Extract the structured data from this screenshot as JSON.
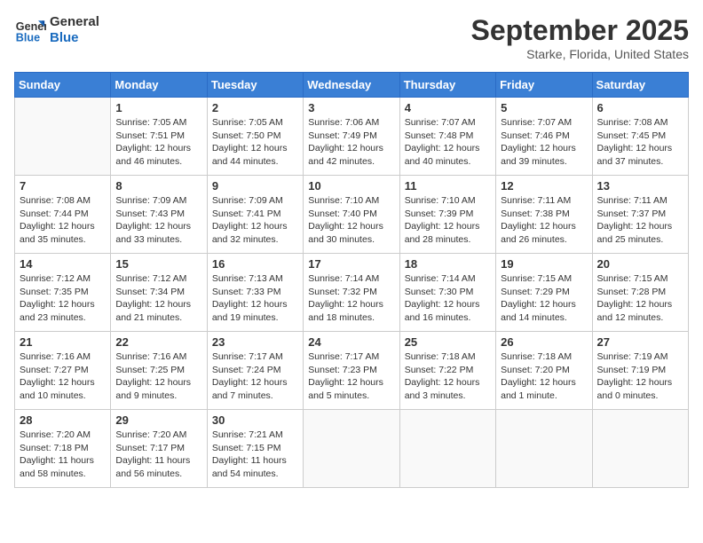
{
  "header": {
    "logo_line1": "General",
    "logo_line2": "Blue",
    "month_title": "September 2025",
    "location": "Starke, Florida, United States"
  },
  "days_of_week": [
    "Sunday",
    "Monday",
    "Tuesday",
    "Wednesday",
    "Thursday",
    "Friday",
    "Saturday"
  ],
  "weeks": [
    [
      {
        "day": "",
        "info": ""
      },
      {
        "day": "1",
        "info": "Sunrise: 7:05 AM\nSunset: 7:51 PM\nDaylight: 12 hours\nand 46 minutes."
      },
      {
        "day": "2",
        "info": "Sunrise: 7:05 AM\nSunset: 7:50 PM\nDaylight: 12 hours\nand 44 minutes."
      },
      {
        "day": "3",
        "info": "Sunrise: 7:06 AM\nSunset: 7:49 PM\nDaylight: 12 hours\nand 42 minutes."
      },
      {
        "day": "4",
        "info": "Sunrise: 7:07 AM\nSunset: 7:48 PM\nDaylight: 12 hours\nand 40 minutes."
      },
      {
        "day": "5",
        "info": "Sunrise: 7:07 AM\nSunset: 7:46 PM\nDaylight: 12 hours\nand 39 minutes."
      },
      {
        "day": "6",
        "info": "Sunrise: 7:08 AM\nSunset: 7:45 PM\nDaylight: 12 hours\nand 37 minutes."
      }
    ],
    [
      {
        "day": "7",
        "info": "Sunrise: 7:08 AM\nSunset: 7:44 PM\nDaylight: 12 hours\nand 35 minutes."
      },
      {
        "day": "8",
        "info": "Sunrise: 7:09 AM\nSunset: 7:43 PM\nDaylight: 12 hours\nand 33 minutes."
      },
      {
        "day": "9",
        "info": "Sunrise: 7:09 AM\nSunset: 7:41 PM\nDaylight: 12 hours\nand 32 minutes."
      },
      {
        "day": "10",
        "info": "Sunrise: 7:10 AM\nSunset: 7:40 PM\nDaylight: 12 hours\nand 30 minutes."
      },
      {
        "day": "11",
        "info": "Sunrise: 7:10 AM\nSunset: 7:39 PM\nDaylight: 12 hours\nand 28 minutes."
      },
      {
        "day": "12",
        "info": "Sunrise: 7:11 AM\nSunset: 7:38 PM\nDaylight: 12 hours\nand 26 minutes."
      },
      {
        "day": "13",
        "info": "Sunrise: 7:11 AM\nSunset: 7:37 PM\nDaylight: 12 hours\nand 25 minutes."
      }
    ],
    [
      {
        "day": "14",
        "info": "Sunrise: 7:12 AM\nSunset: 7:35 PM\nDaylight: 12 hours\nand 23 minutes."
      },
      {
        "day": "15",
        "info": "Sunrise: 7:12 AM\nSunset: 7:34 PM\nDaylight: 12 hours\nand 21 minutes."
      },
      {
        "day": "16",
        "info": "Sunrise: 7:13 AM\nSunset: 7:33 PM\nDaylight: 12 hours\nand 19 minutes."
      },
      {
        "day": "17",
        "info": "Sunrise: 7:14 AM\nSunset: 7:32 PM\nDaylight: 12 hours\nand 18 minutes."
      },
      {
        "day": "18",
        "info": "Sunrise: 7:14 AM\nSunset: 7:30 PM\nDaylight: 12 hours\nand 16 minutes."
      },
      {
        "day": "19",
        "info": "Sunrise: 7:15 AM\nSunset: 7:29 PM\nDaylight: 12 hours\nand 14 minutes."
      },
      {
        "day": "20",
        "info": "Sunrise: 7:15 AM\nSunset: 7:28 PM\nDaylight: 12 hours\nand 12 minutes."
      }
    ],
    [
      {
        "day": "21",
        "info": "Sunrise: 7:16 AM\nSunset: 7:27 PM\nDaylight: 12 hours\nand 10 minutes."
      },
      {
        "day": "22",
        "info": "Sunrise: 7:16 AM\nSunset: 7:25 PM\nDaylight: 12 hours\nand 9 minutes."
      },
      {
        "day": "23",
        "info": "Sunrise: 7:17 AM\nSunset: 7:24 PM\nDaylight: 12 hours\nand 7 minutes."
      },
      {
        "day": "24",
        "info": "Sunrise: 7:17 AM\nSunset: 7:23 PM\nDaylight: 12 hours\nand 5 minutes."
      },
      {
        "day": "25",
        "info": "Sunrise: 7:18 AM\nSunset: 7:22 PM\nDaylight: 12 hours\nand 3 minutes."
      },
      {
        "day": "26",
        "info": "Sunrise: 7:18 AM\nSunset: 7:20 PM\nDaylight: 12 hours\nand 1 minute."
      },
      {
        "day": "27",
        "info": "Sunrise: 7:19 AM\nSunset: 7:19 PM\nDaylight: 12 hours\nand 0 minutes."
      }
    ],
    [
      {
        "day": "28",
        "info": "Sunrise: 7:20 AM\nSunset: 7:18 PM\nDaylight: 11 hours\nand 58 minutes."
      },
      {
        "day": "29",
        "info": "Sunrise: 7:20 AM\nSunset: 7:17 PM\nDaylight: 11 hours\nand 56 minutes."
      },
      {
        "day": "30",
        "info": "Sunrise: 7:21 AM\nSunset: 7:15 PM\nDaylight: 11 hours\nand 54 minutes."
      },
      {
        "day": "",
        "info": ""
      },
      {
        "day": "",
        "info": ""
      },
      {
        "day": "",
        "info": ""
      },
      {
        "day": "",
        "info": ""
      }
    ]
  ]
}
